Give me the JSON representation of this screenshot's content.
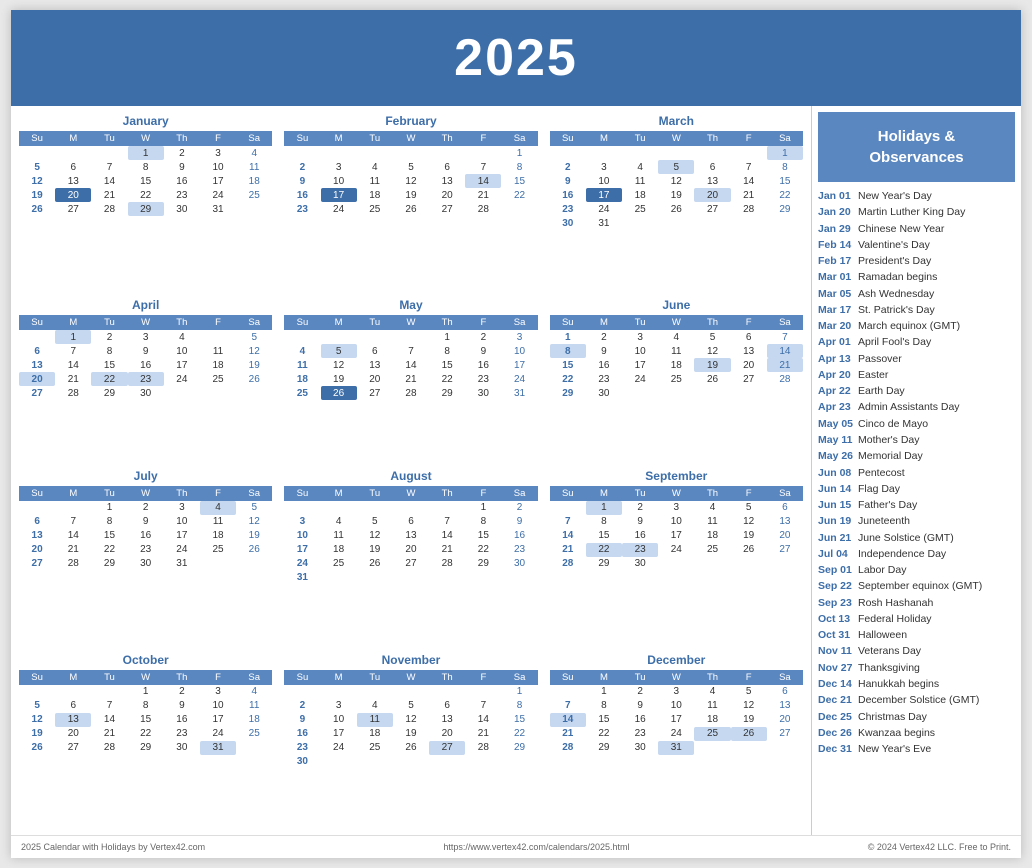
{
  "title": "2025",
  "holidays_header": "Holidays &\nObservances",
  "holidays": [
    {
      "date": "Jan 01",
      "name": "New Year's Day"
    },
    {
      "date": "Jan 20",
      "name": "Martin Luther King Day"
    },
    {
      "date": "Jan 29",
      "name": "Chinese New Year"
    },
    {
      "date": "Feb 14",
      "name": "Valentine's Day"
    },
    {
      "date": "Feb 17",
      "name": "President's Day"
    },
    {
      "date": "Mar 01",
      "name": "Ramadan begins"
    },
    {
      "date": "Mar 05",
      "name": "Ash Wednesday"
    },
    {
      "date": "Mar 17",
      "name": "St. Patrick's Day"
    },
    {
      "date": "Mar 20",
      "name": "March equinox (GMT)"
    },
    {
      "date": "Apr 01",
      "name": "April Fool's Day"
    },
    {
      "date": "Apr 13",
      "name": "Passover"
    },
    {
      "date": "Apr 20",
      "name": "Easter"
    },
    {
      "date": "Apr 22",
      "name": "Earth Day"
    },
    {
      "date": "Apr 23",
      "name": "Admin Assistants Day"
    },
    {
      "date": "May 05",
      "name": "Cinco de Mayo"
    },
    {
      "date": "May 11",
      "name": "Mother's Day"
    },
    {
      "date": "May 26",
      "name": "Memorial Day"
    },
    {
      "date": "Jun 08",
      "name": "Pentecost"
    },
    {
      "date": "Jun 14",
      "name": "Flag Day"
    },
    {
      "date": "Jun 15",
      "name": "Father's Day"
    },
    {
      "date": "Jun 19",
      "name": "Juneteenth"
    },
    {
      "date": "Jun 21",
      "name": "June Solstice (GMT)"
    },
    {
      "date": "Jul 04",
      "name": "Independence Day"
    },
    {
      "date": "Sep 01",
      "name": "Labor Day"
    },
    {
      "date": "Sep 22",
      "name": "September equinox (GMT)"
    },
    {
      "date": "Sep 23",
      "name": "Rosh Hashanah"
    },
    {
      "date": "Oct 13",
      "name": "Federal Holiday"
    },
    {
      "date": "Oct 31",
      "name": "Halloween"
    },
    {
      "date": "Nov 11",
      "name": "Veterans Day"
    },
    {
      "date": "Nov 27",
      "name": "Thanksgiving"
    },
    {
      "date": "Dec 14",
      "name": "Hanukkah begins"
    },
    {
      "date": "Dec 21",
      "name": "December Solstice (GMT)"
    },
    {
      "date": "Dec 25",
      "name": "Christmas Day"
    },
    {
      "date": "Dec 26",
      "name": "Kwanzaa begins"
    },
    {
      "date": "Dec 31",
      "name": "New Year's Eve"
    }
  ],
  "footer_left": "2025 Calendar with Holidays by Vertex42.com",
  "footer_center": "https://www.vertex42.com/calendars/2025.html",
  "footer_right": "© 2024 Vertex42 LLC. Free to Print."
}
